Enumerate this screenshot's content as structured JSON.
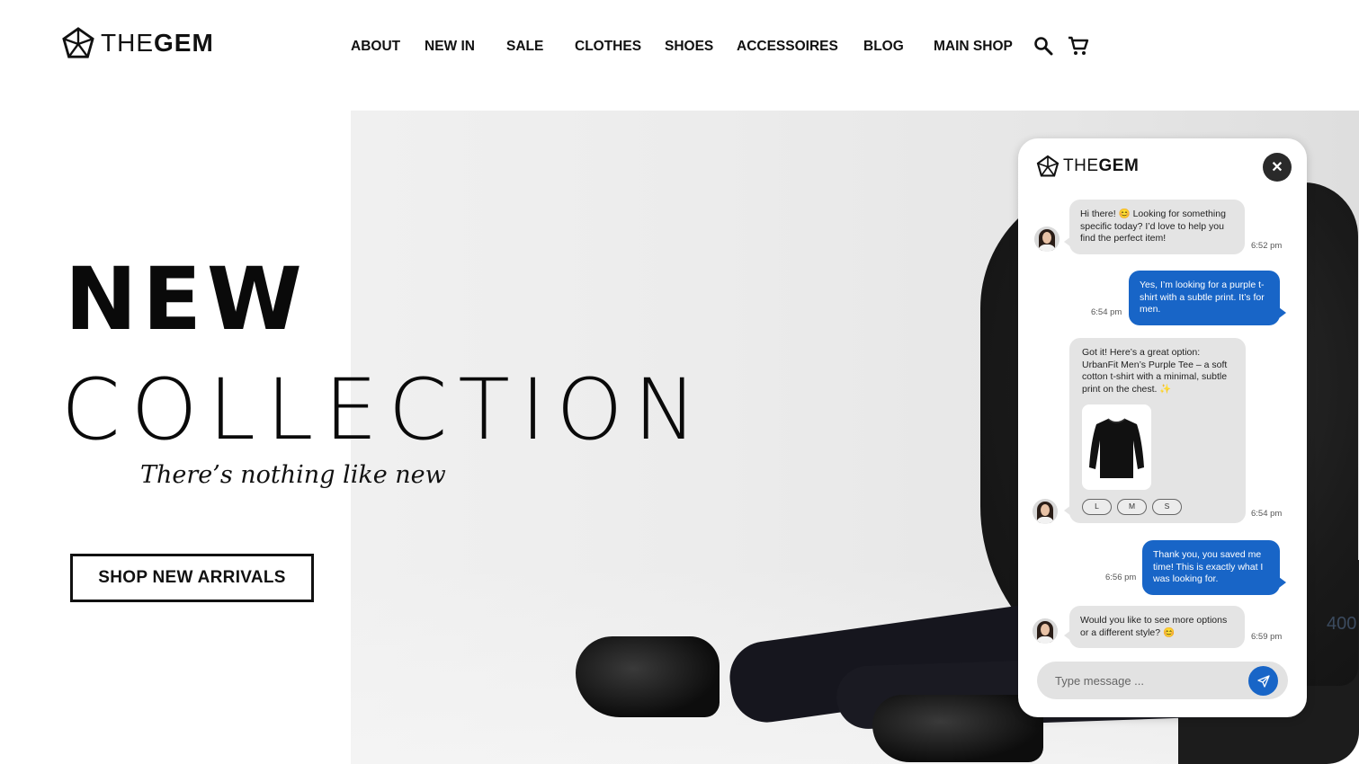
{
  "brand": {
    "name_light": "THE",
    "name_bold": "GEM"
  },
  "nav": {
    "items": [
      {
        "label": "ABOUT"
      },
      {
        "label": "NEW IN"
      },
      {
        "label": "SALE"
      },
      {
        "label": "CLOTHES"
      },
      {
        "label": "SHOES"
      },
      {
        "label": "ACCESSOIRES"
      },
      {
        "label": "BLOG"
      },
      {
        "label": "MAIN SHOP"
      }
    ],
    "search_icon": "search-icon",
    "cart_icon": "cart-icon"
  },
  "hero": {
    "title_line1": "NEW",
    "title_line2": "COLLECTION",
    "tagline": "There’s nothing like new",
    "cta_label": "SHOP NEW ARRIVALS"
  },
  "chat": {
    "brand_light": "THE",
    "brand_bold": "GEM",
    "close_symbol": "✕",
    "messages": [
      {
        "from": "agent",
        "text": "Hi there! 😊 Looking for something specific today? I’d love to help you find the perfect item!",
        "time": "6:52 pm"
      },
      {
        "from": "user",
        "text": "Yes, I’m looking for a purple t-shirt with a subtle print. It’s for men.",
        "time": "6:54 pm"
      },
      {
        "from": "agent",
        "text": "Got it! Here’s a great option: UrbanFit Men’s Purple Tee – a soft cotton t-shirt with a minimal, subtle print on the chest. ✨",
        "time": "6:54 pm",
        "sizes": [
          "L",
          "M",
          "S"
        ]
      },
      {
        "from": "user",
        "text": "Thank you, you saved me time! This is exactly what I was looking for.",
        "time": "6:56 pm"
      },
      {
        "from": "agent",
        "text": "Would you like to see more options or a different style? 😊",
        "time": "6:59 pm"
      }
    ],
    "input_placeholder": "Type message ...",
    "colors": {
      "accent": "#1865c7",
      "agent_bubble": "#e4e4e4",
      "close_bg": "#2a2a2a"
    }
  },
  "background_box_text": "400"
}
